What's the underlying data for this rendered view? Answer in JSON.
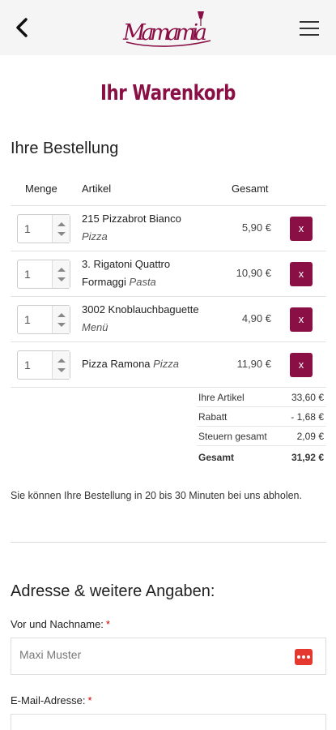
{
  "header": {
    "logo_text": "Mamamia",
    "back_icon": "chevron-left-icon",
    "menu_icon": "hamburger-menu-icon",
    "brand_color": "#8a0f45"
  },
  "page_title": "Ihr Warenkorb",
  "order": {
    "section_title": "Ihre Bestellung",
    "columns": {
      "qty": "Menge",
      "article": "Artikel",
      "total": "Gesamt"
    },
    "items": [
      {
        "qty": "1",
        "name": "215 Pizzabrot Bianco",
        "category": "Pizza",
        "price": "5,90 €",
        "remove_label": "x"
      },
      {
        "qty": "1",
        "name": "3. Rigatoni Quattro Formaggi",
        "category": "Pasta",
        "price": "10,90 €",
        "remove_label": "x"
      },
      {
        "qty": "1",
        "name": "3002 Knoblauchbaguette",
        "category": "Menü",
        "price": "4,90 €",
        "remove_label": "x"
      },
      {
        "qty": "1",
        "name": "Pizza Ramona",
        "category": "Pizza",
        "price": "11,90 €",
        "remove_label": "x"
      }
    ]
  },
  "totals": {
    "items_label": "Ihre Artikel",
    "items_value": "33,60 €",
    "discount_label": "Rabatt",
    "discount_value": "- 1,68 €",
    "tax_label": "Steuern gesamt",
    "tax_value": "2,09 €",
    "total_label": "Gesamt",
    "total_value": "31,92 €"
  },
  "pickup_note": "Sie können Ihre Bestellung in 20 bis 30 Minuten bei uns abholen.",
  "address": {
    "section_title": "Adresse & weitere Angaben:",
    "name_label": "Vor und Nachname:",
    "name_placeholder": "Maxi Muster",
    "email_label": "E-Mail-Adresse:",
    "required_mark": "*"
  }
}
